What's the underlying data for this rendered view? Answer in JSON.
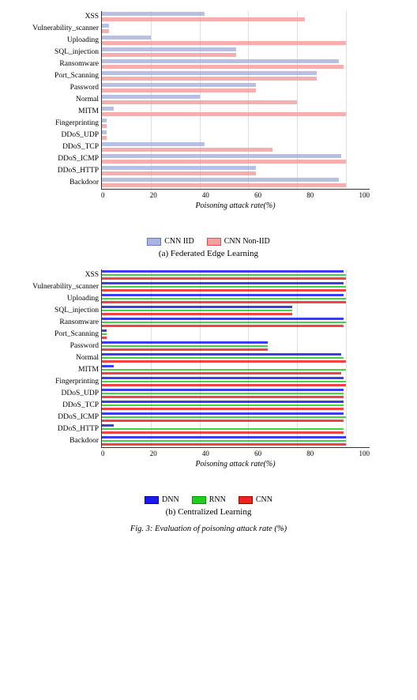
{
  "charts": [
    {
      "id": "chart-a",
      "caption": "(a) Federated Edge Learning",
      "x_axis_title": "Poisoning attack rate(%)",
      "x_ticks": [
        "0",
        "20",
        "40",
        "60",
        "80",
        "100"
      ],
      "max_val": 110,
      "legend": [
        {
          "label": "CNN IID",
          "color": "#aab4e0",
          "border": "#6677cc"
        },
        {
          "label": "CNN Non-IID",
          "color": "#f4a0a0",
          "border": "#e05050"
        }
      ],
      "bars": [
        {
          "label": "XSS",
          "vals": [
            42,
            83
          ]
        },
        {
          "label": "Vulnerability_scanner",
          "vals": [
            3,
            3
          ]
        },
        {
          "label": "Uploading",
          "vals": [
            20,
            100
          ]
        },
        {
          "label": "SQL_injection",
          "vals": [
            55,
            55
          ]
        },
        {
          "label": "Ransomware",
          "vals": [
            97,
            99
          ]
        },
        {
          "label": "Port_Scanning",
          "vals": [
            88,
            88
          ]
        },
        {
          "label": "Password",
          "vals": [
            63,
            63
          ]
        },
        {
          "label": "Normal",
          "vals": [
            40,
            80
          ]
        },
        {
          "label": "MITM",
          "vals": [
            5,
            100
          ]
        },
        {
          "label": "Fingerprinting",
          "vals": [
            2,
            2
          ]
        },
        {
          "label": "DDoS_UDP",
          "vals": [
            2,
            2
          ]
        },
        {
          "label": "DDoS_TCP",
          "vals": [
            42,
            70
          ]
        },
        {
          "label": "DDoS_ICMP",
          "vals": [
            98,
            100
          ]
        },
        {
          "label": "DDoS_HTTP",
          "vals": [
            63,
            63
          ]
        },
        {
          "label": "Backdoor",
          "vals": [
            97,
            100
          ]
        }
      ],
      "colors": [
        "#aab4e0",
        "#f4a0a0"
      ]
    },
    {
      "id": "chart-b",
      "caption": "(b) Centralized Learning",
      "x_axis_title": "Poisoning attack rate(%)",
      "x_ticks": [
        "0",
        "20",
        "40",
        "60",
        "80",
        "100"
      ],
      "max_val": 110,
      "legend": [
        {
          "label": "DNN",
          "color": "#1a1aee",
          "border": "#0000aa"
        },
        {
          "label": "RNN",
          "color": "#22cc22",
          "border": "#009900"
        },
        {
          "label": "CNN",
          "color": "#ee2222",
          "border": "#aa0000"
        }
      ],
      "bars": [
        {
          "label": "XSS",
          "vals": [
            99,
            100,
            100
          ]
        },
        {
          "label": "Vulnerability_scanner",
          "vals": [
            99,
            100,
            100
          ]
        },
        {
          "label": "Uploading",
          "vals": [
            99,
            100,
            100
          ]
        },
        {
          "label": "SQL_injection",
          "vals": [
            78,
            78,
            78
          ]
        },
        {
          "label": "Ransomware",
          "vals": [
            99,
            100,
            99
          ]
        },
        {
          "label": "Port_Scanning",
          "vals": [
            2,
            2,
            2
          ]
        },
        {
          "label": "Password",
          "vals": [
            68,
            68,
            68
          ]
        },
        {
          "label": "Normal",
          "vals": [
            98,
            99,
            100
          ]
        },
        {
          "label": "MITM",
          "vals": [
            5,
            100,
            98
          ]
        },
        {
          "label": "Fingerprinting",
          "vals": [
            99,
            100,
            100
          ]
        },
        {
          "label": "DDoS_UDP",
          "vals": [
            99,
            99,
            99
          ]
        },
        {
          "label": "DDoS_TCP",
          "vals": [
            99,
            99,
            99
          ]
        },
        {
          "label": "DDoS_ICMP",
          "vals": [
            99,
            100,
            99
          ]
        },
        {
          "label": "DDoS_HTTP",
          "vals": [
            5,
            99,
            99
          ]
        },
        {
          "label": "Backdoor",
          "vals": [
            100,
            100,
            100
          ]
        }
      ],
      "colors": [
        "#1a1aee",
        "#22cc22",
        "#ee2222"
      ]
    }
  ],
  "figure_caption": "Fig. 3: Evaluation of poisoning attack rate (%)"
}
